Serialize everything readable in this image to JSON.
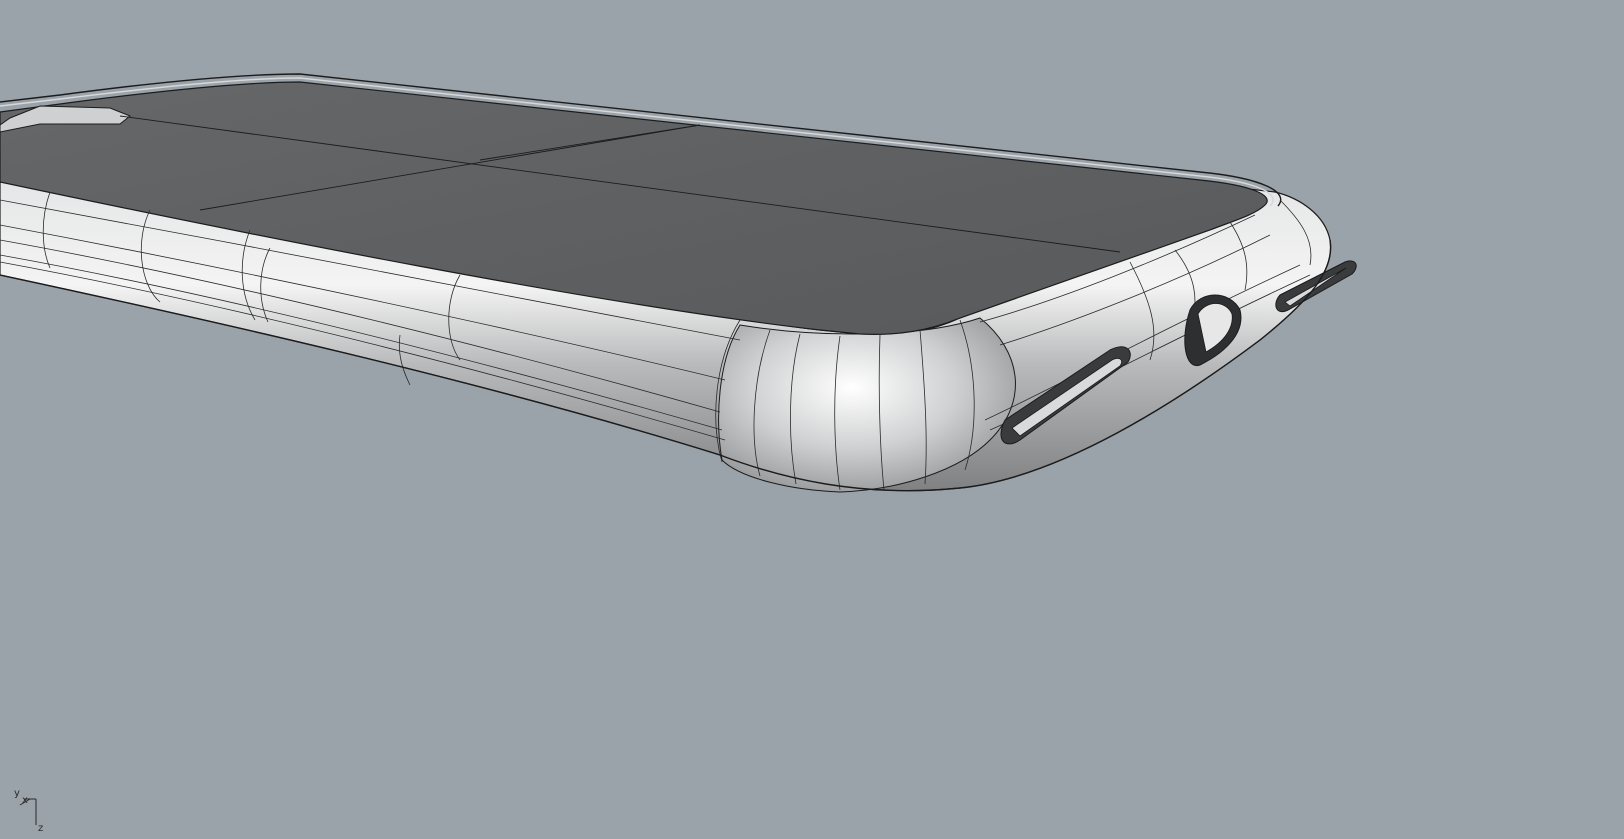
{
  "viewport": {
    "background_color": "#9aa2aa",
    "display_mode": "shaded-with-isocurves"
  },
  "model": {
    "description_icon": "phone-case-3d-model",
    "top_face_color": "#5d5f62",
    "rim_color": "#c9cacb",
    "edge_color": "#1c1c1c"
  },
  "axis_gizmo": {
    "y_label": "y",
    "x_label": "x",
    "z_label": "z"
  }
}
